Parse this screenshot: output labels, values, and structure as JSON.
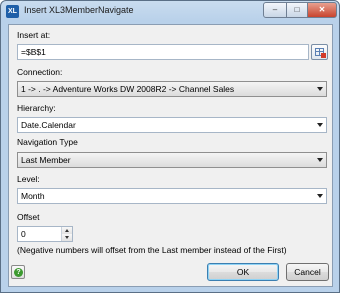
{
  "window": {
    "app_icon": "XL",
    "title": "Insert XL3MemberNavigate",
    "minimize": "–",
    "maximize": "□",
    "close": "✕"
  },
  "form": {
    "insert_at": {
      "label": "Insert at:",
      "value": "=$B$1",
      "picker_icon": "range-picker-icon"
    },
    "connection": {
      "label": "Connection:",
      "value": "1 -> . -> Adventure Works DW 2008R2 -> Channel Sales"
    },
    "hierarchy": {
      "label": "Hierarchy:",
      "value": "Date.Calendar"
    },
    "navigation_type": {
      "label": "Navigation Type",
      "value": "Last Member"
    },
    "level": {
      "label": "Level:",
      "value": "Month"
    },
    "offset": {
      "label": "Offset",
      "value": "0"
    },
    "note": "(Negative numbers will offset from the Last member instead of the First)"
  },
  "footer": {
    "help_icon": "?",
    "ok_label": "OK",
    "cancel_label": "Cancel"
  },
  "colors": {
    "frame": "#b9d1ea",
    "client_bg": "#f0f0f0",
    "close_button": "#c8442e",
    "default_button_border": "#3c7fb1"
  }
}
